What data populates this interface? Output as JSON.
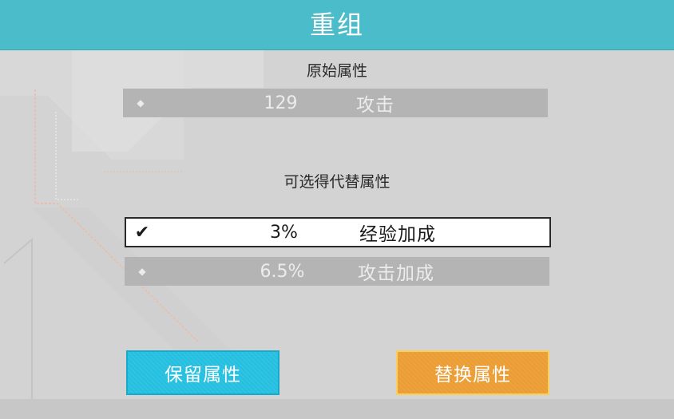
{
  "dialog": {
    "title": "重组",
    "original_label": "原始属性",
    "original_attribute": {
      "marker": "◆",
      "value": "129",
      "name": "攻击"
    },
    "options_label": "可选得代替属性",
    "options": [
      {
        "marker": "✔",
        "value": "3%",
        "name": "经验加成",
        "selected": true
      },
      {
        "marker": "◆",
        "value": "6.5%",
        "name": "攻击加成",
        "selected": false
      }
    ],
    "buttons": {
      "keep_label": "保留属性",
      "replace_label": "替换属性"
    }
  },
  "colors": {
    "title_bar": "#4bbcc9",
    "panel": "#d3d3d3",
    "row_disabled": "#b4b4b4",
    "keep_button": "#24bfe0",
    "replace_button": "#eb9d33"
  }
}
